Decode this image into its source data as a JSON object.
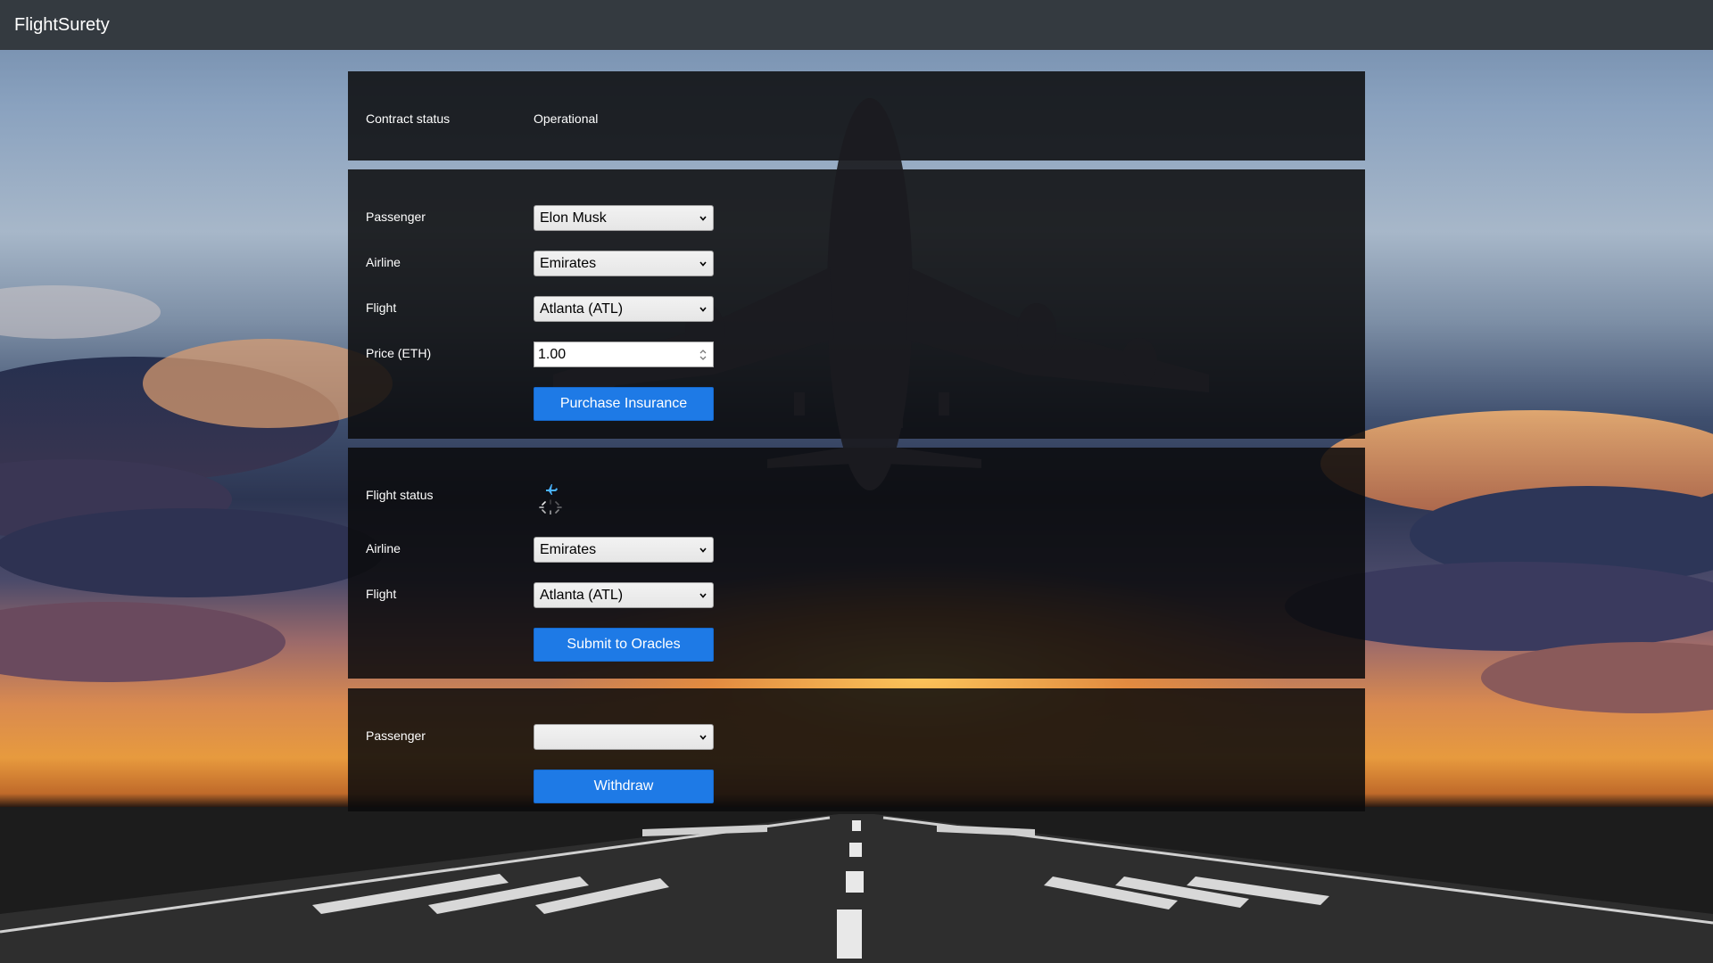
{
  "app": {
    "brand": "FlightSurety"
  },
  "status_panel": {
    "label": "Contract status",
    "value": "Operational"
  },
  "insurance_panel": {
    "passenger_label": "Passenger",
    "passenger_value": "Elon Musk",
    "airline_label": "Airline",
    "airline_value": "Emirates",
    "flight_label": "Flight",
    "flight_value": "Atlanta (ATL)",
    "price_label": "Price (ETH)",
    "price_value": "1.00",
    "purchase_button": "Purchase Insurance"
  },
  "oracles_panel": {
    "flight_status_label": "Flight status",
    "status_icon": "loading-spinner-with-plane-icon",
    "airline_label": "Airline",
    "airline_value": "Emirates",
    "flight_label": "Flight",
    "flight_value": "Atlanta (ATL)",
    "submit_button": "Submit to Oracles"
  },
  "withdraw_panel": {
    "passenger_label": "Passenger",
    "passenger_value": "",
    "withdraw_button": "Withdraw"
  },
  "colors": {
    "navbar": "#343a40",
    "button": "#1e7ae6",
    "panel": "rgba(10,10,12,0.86)"
  }
}
